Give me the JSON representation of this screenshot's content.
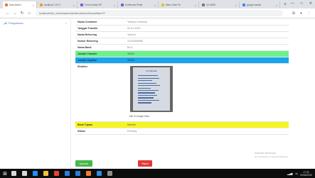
{
  "browser": {
    "tabs": [
      {
        "label": "Data Admin",
        "color": "#e8773b",
        "active": true
      },
      {
        "label": "localhost / 127.0",
        "color": "#f29b1f",
        "active": false
      },
      {
        "label": "Form Koreksi SP",
        "color": "#8a56c8",
        "active": false
      },
      {
        "label": "Konfirmasi Pemb",
        "color": "#8a56c8",
        "active": false
      },
      {
        "label": "Menu Kirim Pe",
        "color": "#e3c21a",
        "active": false
      },
      {
        "label": "CD WEB ",
        "color": "#777777",
        "active": false
      },
      {
        "label": "google transla",
        "color": "#4285f4",
        "active": false
      }
    ],
    "new_tab": "+",
    "url": "localhost/edu_online/aspera/konfirmasi/konfirmasi/fakerXT",
    "icons": {
      "back": "←",
      "forward": "→",
      "reload": "↻",
      "home": "⌂",
      "extensions": "⊞",
      "profile": "●",
      "menu": "⋮"
    },
    "window_controls": {
      "minimize": "—",
      "maximize": "□",
      "close": "✕"
    }
  },
  "sidebar": {
    "items": [
      {
        "label": "Pengaturan",
        "icon": "wrench-icon",
        "chevron": "<"
      }
    ]
  },
  "detail": {
    "rows": [
      {
        "label": "Nama Customer",
        "value": "Yadnya Lestarina",
        "style": ""
      },
      {
        "label": "Tanggal Transfer",
        "value": "03-01-2020",
        "style": ""
      },
      {
        "label": "Nama Rekening",
        "value": "Yasmin",
        "style": ""
      },
      {
        "label": "Nomor Rekening",
        "value": "12334556888",
        "style": ""
      },
      {
        "label": "Nama Bank",
        "value": "BCA",
        "style": ""
      },
      {
        "label": "Jumlah Transfer",
        "value": "30000",
        "style": "green"
      },
      {
        "label": "Jumlah Tagihan",
        "value": "30000",
        "style": "blue"
      }
    ],
    "evidence": {
      "label": "Struktur",
      "receipt_title": "m-Transfer",
      "click_text": "klik To Image View"
    },
    "rows_after": [
      {
        "label": "Bank Tujuan",
        "value": "Mandiri",
        "style": "yellow"
      },
      {
        "label": "Status",
        "value": "Pending",
        "style": ""
      }
    ]
  },
  "actions": {
    "approve_label": "Approve",
    "reject_label": "Reject",
    "approve_color": "#48b74b",
    "reject_color": "#e23a3a"
  },
  "watermark": {
    "title": "Activate Windows",
    "subtitle": "Go to Settings to activate Windows."
  },
  "taskbar": {
    "apps": [
      {
        "name": "search-icon",
        "color": "#d8d8d8"
      },
      {
        "name": "task-view-icon",
        "color": "#d8d8d8"
      },
      {
        "name": "edge-icon",
        "color": "#1e90ff"
      },
      {
        "name": "file-explorer-icon",
        "color": "#f3c23a"
      },
      {
        "name": "chrome-icon",
        "color": "#e94235"
      },
      {
        "name": "store-icon",
        "color": "#2a7de1"
      },
      {
        "name": "mail-icon",
        "color": "#2a7de1"
      },
      {
        "name": "xampp-icon",
        "color": "#f77a2c"
      },
      {
        "name": "vscode-icon",
        "color": "#2b8de6"
      },
      {
        "name": "terminal-icon",
        "color": "#8c8c8c"
      }
    ],
    "time": "17:32",
    "date": "03/06/2020"
  }
}
